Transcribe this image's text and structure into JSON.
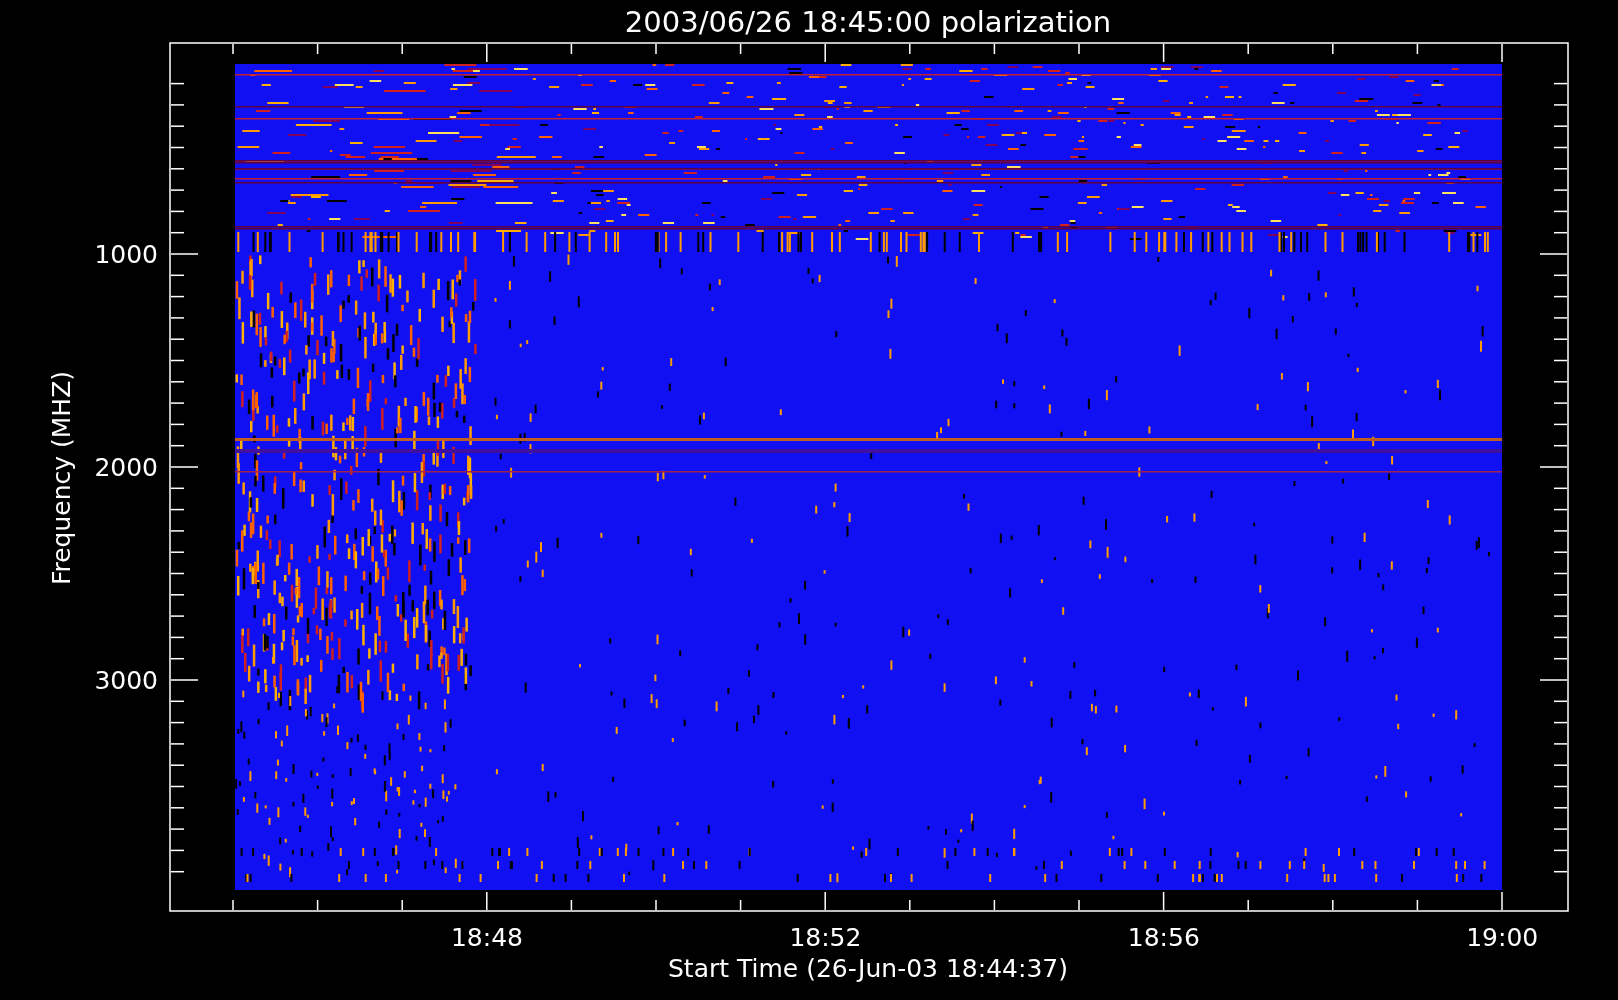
{
  "title": "2003/06/26 18:45:00 polarization",
  "y_axis": {
    "label": "Frequency (MHZ)",
    "ticks": [
      "1000",
      "2000",
      "3000"
    ]
  },
  "x_axis": {
    "label": "Start Time (26-Jun-03 18:44:37)",
    "ticks": [
      "18:48",
      "18:52",
      "18:56",
      "19:00"
    ]
  }
}
